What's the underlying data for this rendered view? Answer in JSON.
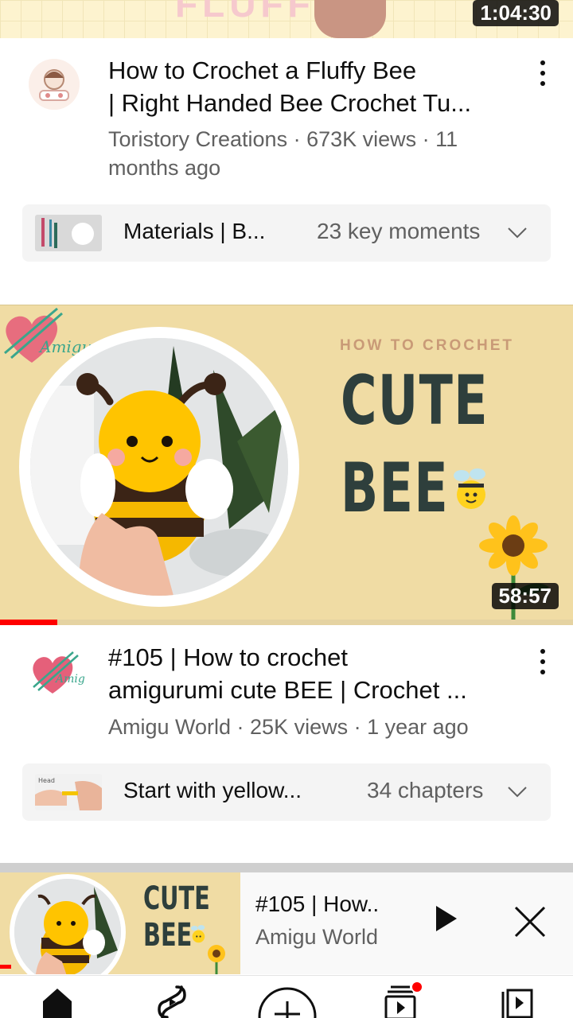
{
  "top_video": {
    "thumbnail_text": "FLUFFY B",
    "duration": "1:04:30",
    "title_line1": "How to Crochet a Fluffy Bee",
    "title_line2": "| Right Handed Bee Crochet Tu...",
    "meta_line1": "Toristory Creations · 673K views · 11",
    "meta_line2": "months ago",
    "chapters": {
      "name": "Materials | B...",
      "count": "23 key moments"
    }
  },
  "bee_video": {
    "thumbnail": {
      "kicker": "HOW TO CROCHET",
      "line1": "CUTE",
      "line2": "BEE",
      "brand": "Amigu"
    },
    "duration": "58:57",
    "watch_progress": 0.1,
    "title_line1": "#105 | How to crochet",
    "title_line2": "amigurumi cute BEE | Crochet ...",
    "meta_line1": "Amigu World · 25K views · 1 year ago",
    "chapters": {
      "name": "Start with yellow...",
      "count": "34 chapters"
    }
  },
  "mini_player": {
    "thumb_line1": "CUTE",
    "thumb_line2": "BEE",
    "title": "#105 | How..",
    "channel": "Amigu World",
    "progress": 0.02
  },
  "bottom_nav": {
    "items": [
      "home-icon",
      "shorts-icon",
      "create-icon",
      "subscriptions-icon",
      "library-icon"
    ],
    "notification_dot": true
  },
  "colors": {
    "progress": "#ff0000",
    "secondary_text": "#606060",
    "thumbnail_bg": "#f0dca4",
    "title_text": "#2e3f3c"
  }
}
